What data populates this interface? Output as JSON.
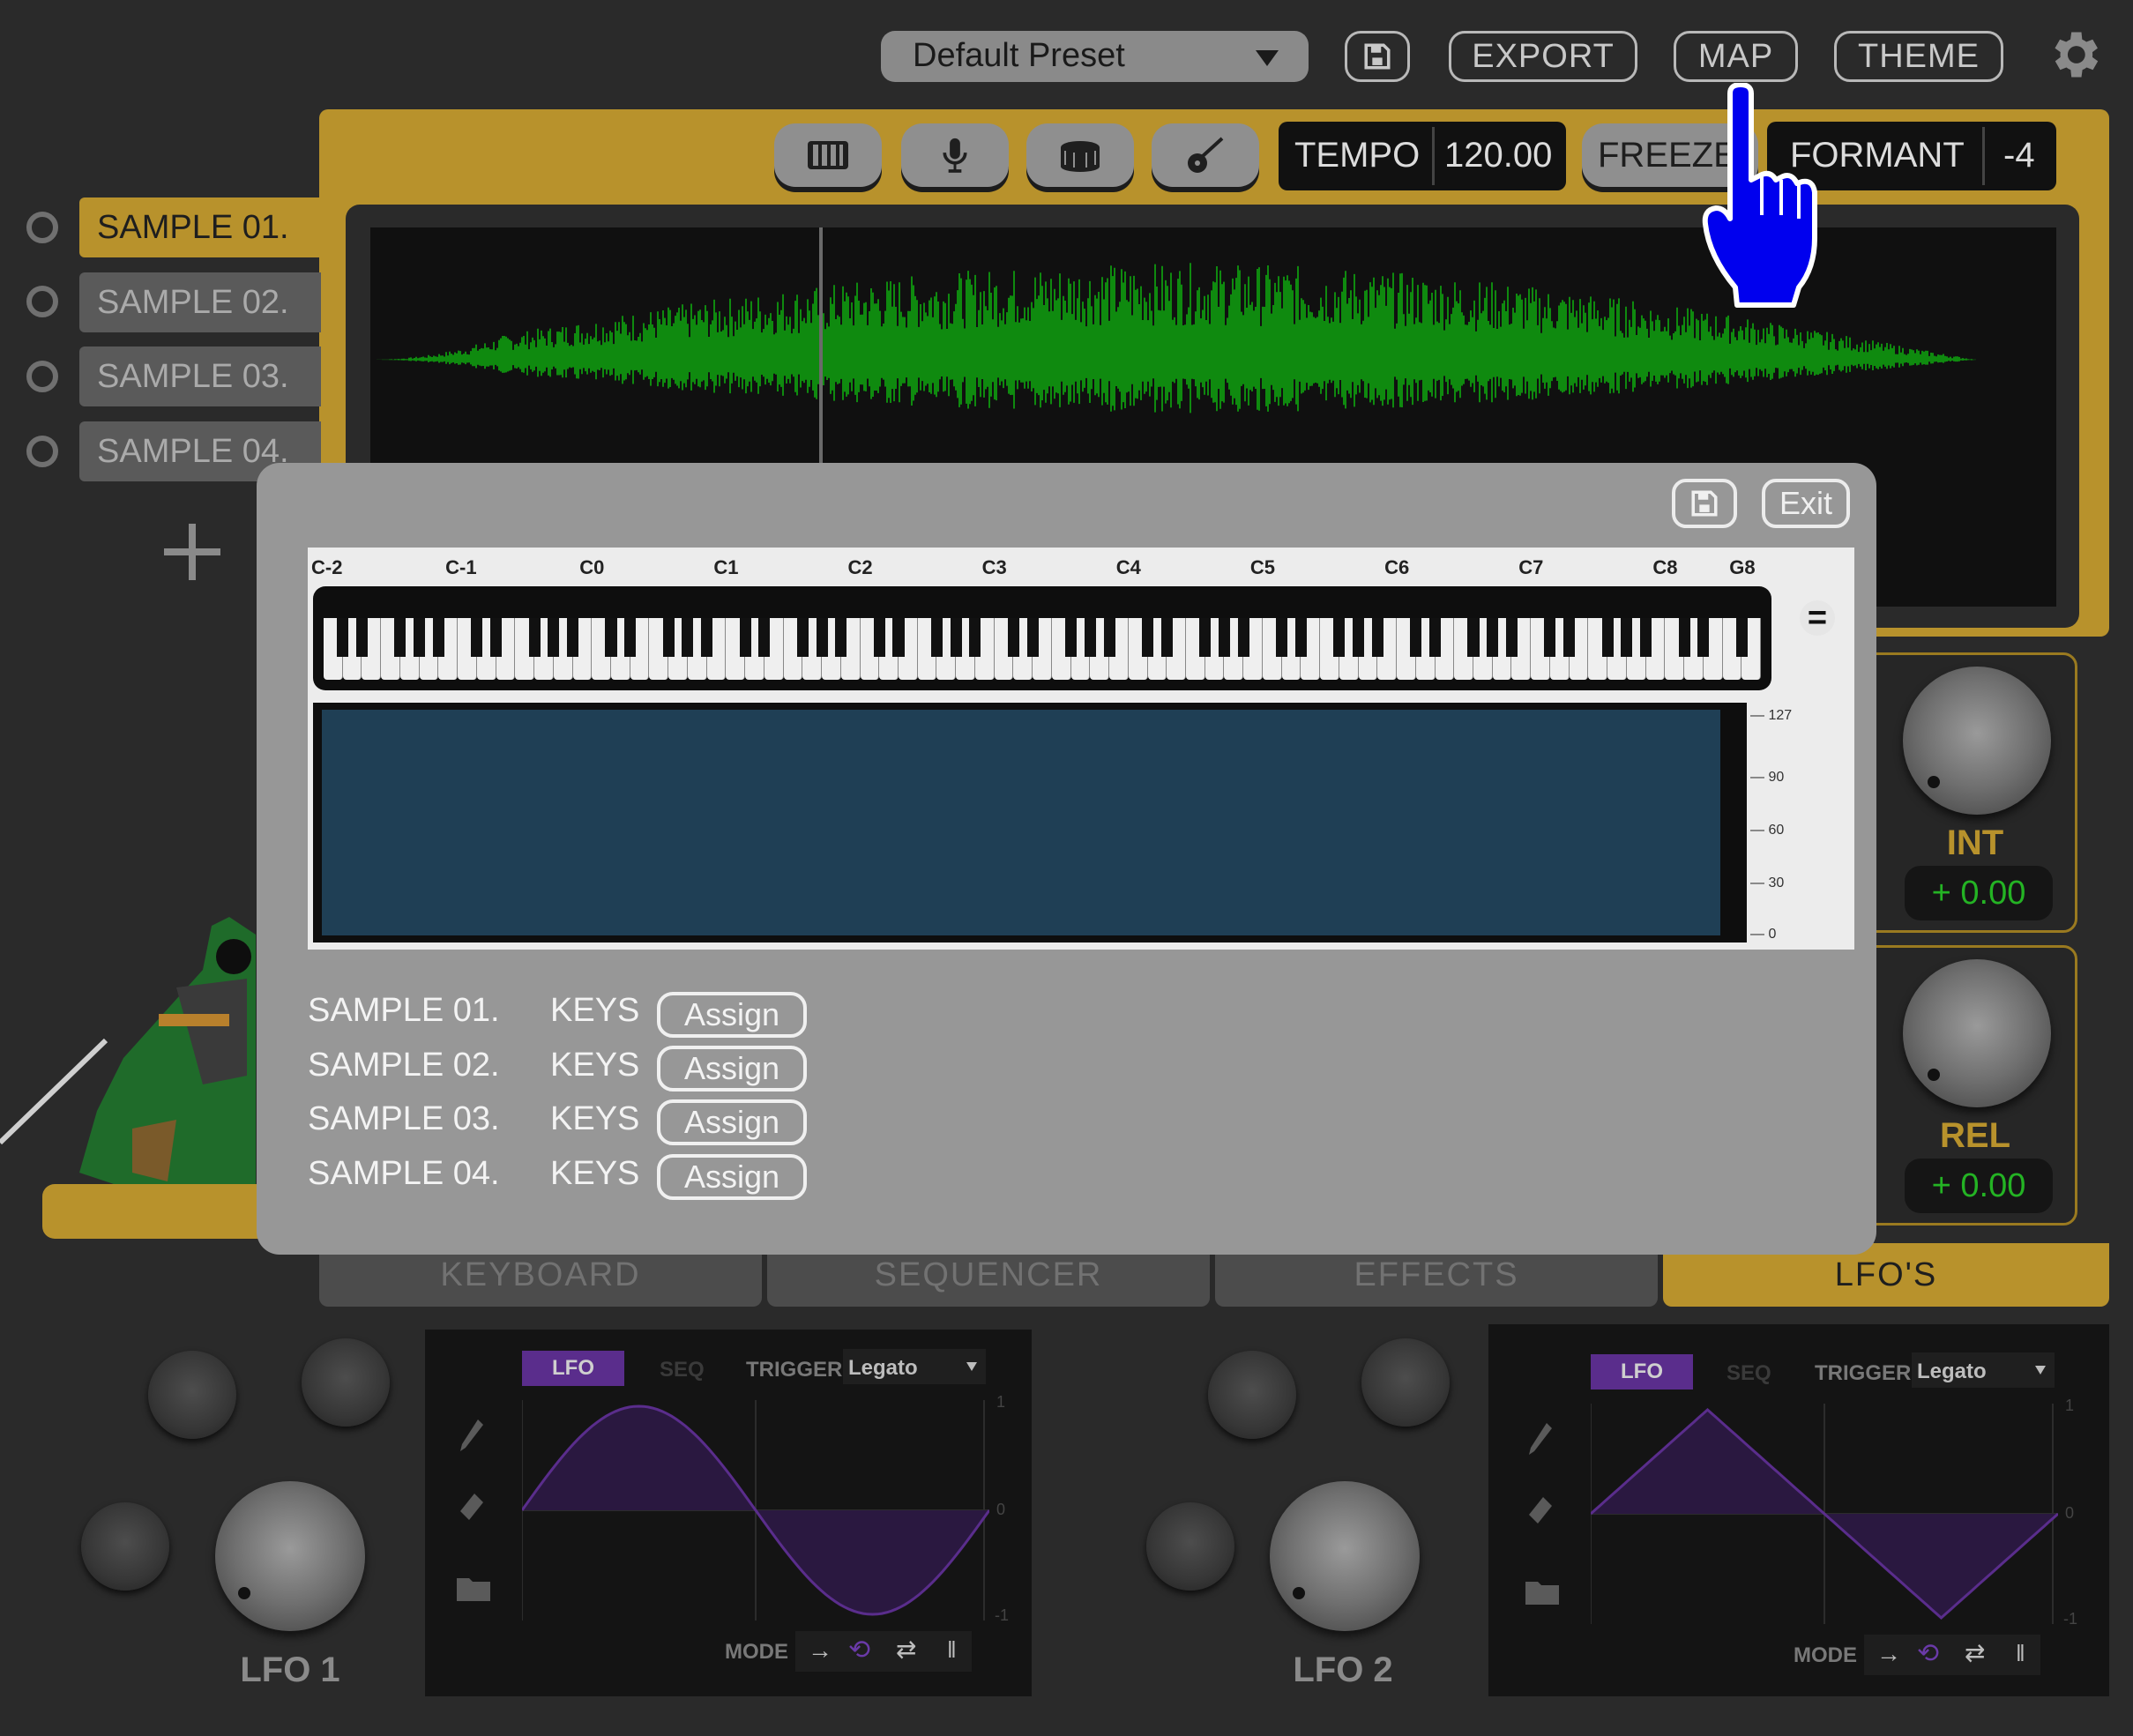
{
  "header": {
    "preset": "Default Preset",
    "save_icon": "save-icon",
    "export": "EXPORT",
    "map": "MAP",
    "theme": "THEME",
    "settings_icon": "gear-icon"
  },
  "toolbar": {
    "modes": [
      {
        "icon": "piano-icon"
      },
      {
        "icon": "microphone-icon"
      },
      {
        "icon": "drum-icon"
      },
      {
        "icon": "guitar-icon"
      }
    ],
    "tempo_label": "TEMPO",
    "tempo_value": "120.00",
    "freeze_label": "FREEZE",
    "formant_label": "FORMANT",
    "formant_value": "-4"
  },
  "samples": [
    "SAMPLE 01.",
    "SAMPLE 02.",
    "SAMPLE 03.",
    "SAMPLE 04."
  ],
  "add_icon": "plus-icon",
  "knobs": {
    "int_label": "INT",
    "int_value": "+ 0.00",
    "rel_label": "REL",
    "rel_value": "+ 0.00"
  },
  "tabs": [
    "KEYBOARD",
    "SEQUENCER",
    "EFFECTS",
    "LFO'S"
  ],
  "lfo": [
    {
      "label": "LFO 1",
      "tab_lfo": "LFO",
      "tab_seq": "SEQ",
      "trigger_label": "TRIGGER",
      "trigger_value": "Legato",
      "mode_label": "MODE",
      "shape": "sine",
      "axis": [
        "1",
        "0",
        "-1"
      ]
    },
    {
      "label": "LFO 2",
      "tab_lfo": "LFO",
      "tab_seq": "SEQ",
      "trigger_label": "TRIGGER",
      "trigger_value": "Legato",
      "mode_label": "MODE",
      "shape": "triangle",
      "axis": [
        "1",
        "0",
        "-1"
      ]
    }
  ],
  "modal": {
    "exit": "Exit",
    "octaves": [
      "C-2",
      "C-1",
      "C0",
      "C1",
      "C2",
      "C3",
      "C4",
      "C5",
      "C6",
      "C7",
      "C8",
      "G8"
    ],
    "velocity_ticks": [
      "127",
      "90",
      "60",
      "30",
      "0"
    ],
    "equals_icon": "equals-icon",
    "rows": [
      {
        "sample": "SAMPLE 01.",
        "type": "KEYS",
        "button": "Assign"
      },
      {
        "sample": "SAMPLE 02.",
        "type": "KEYS",
        "button": "Assign"
      },
      {
        "sample": "SAMPLE 03.",
        "type": "KEYS",
        "button": "Assign"
      },
      {
        "sample": "SAMPLE 04.",
        "type": "KEYS",
        "button": "Assign"
      }
    ]
  },
  "colors": {
    "accent": "#b8922c",
    "waveform": "#0f8a0f",
    "value_green": "#24b324",
    "lfo_purple": "#5a2d8c",
    "pointer_blue": "#0000ee"
  }
}
